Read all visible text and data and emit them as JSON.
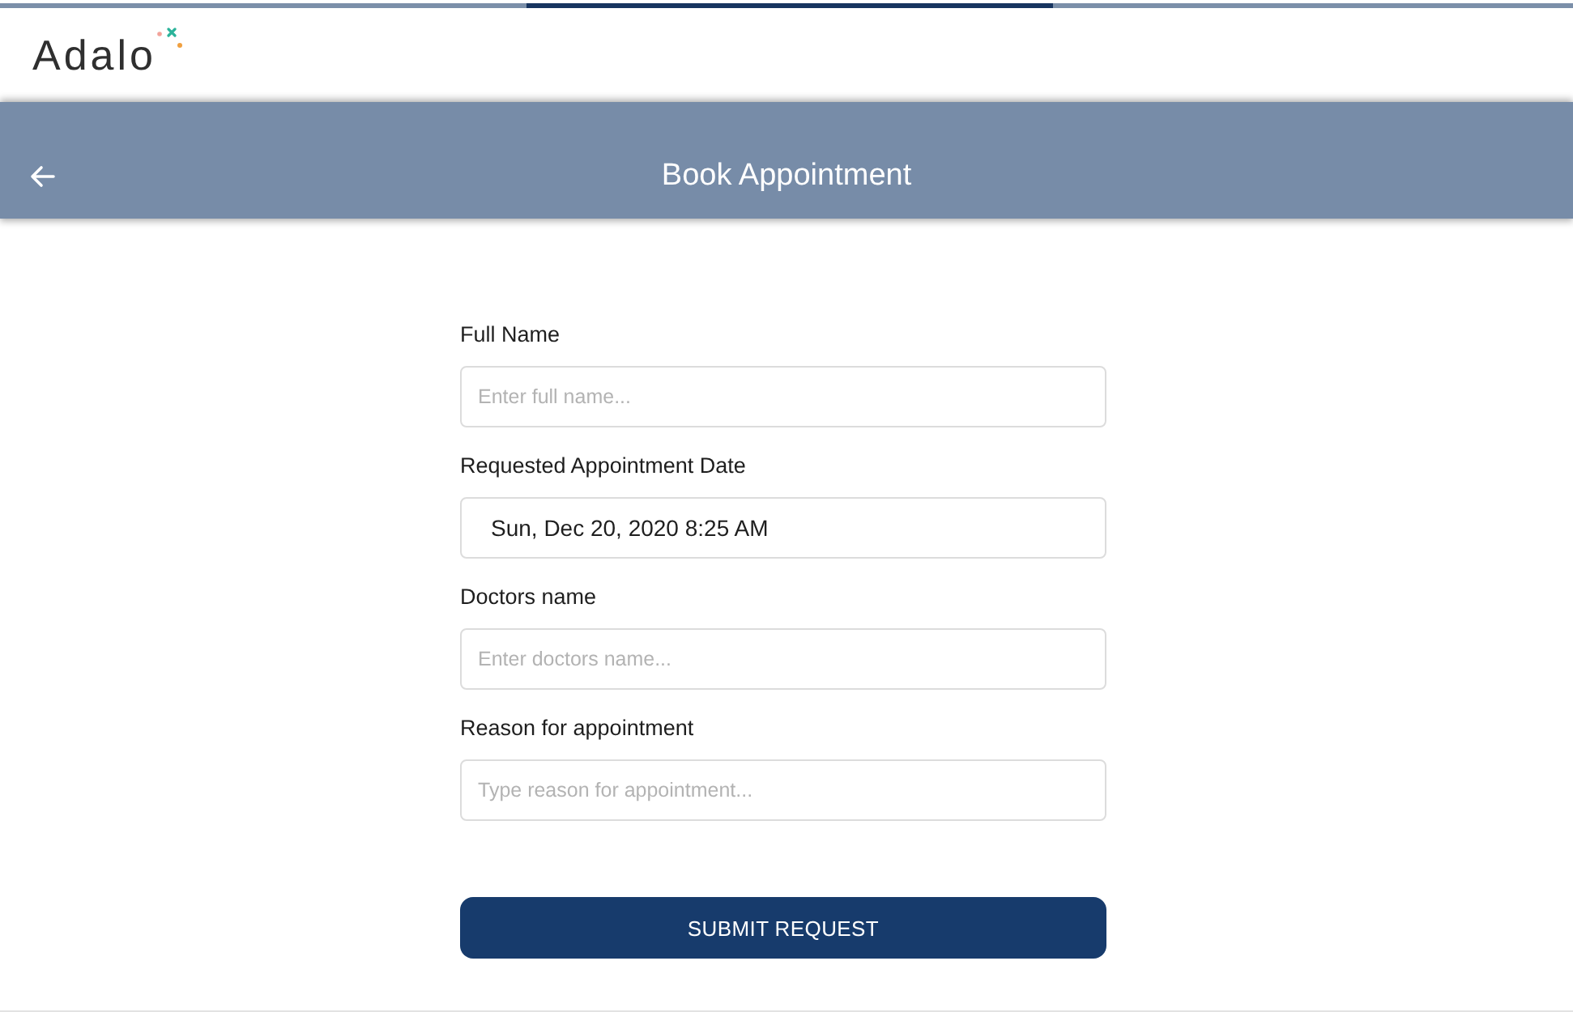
{
  "header": {
    "logo": "Adalo"
  },
  "nav_bar": {
    "title": "Book Appointment"
  },
  "form": {
    "fields": [
      {
        "kind": "text",
        "label": "Full Name",
        "placeholder": "Enter full name..."
      },
      {
        "kind": "date",
        "label": "Requested Appointment Date",
        "value": "Sun, Dec 20, 2020 8:25 AM"
      },
      {
        "kind": "text",
        "label": "Doctors name",
        "placeholder": "Enter doctors name..."
      },
      {
        "kind": "text",
        "label": "Reason for appointment",
        "placeholder": "Type reason for appointment..."
      }
    ],
    "submit_button": "SUBMIT REQUEST"
  }
}
